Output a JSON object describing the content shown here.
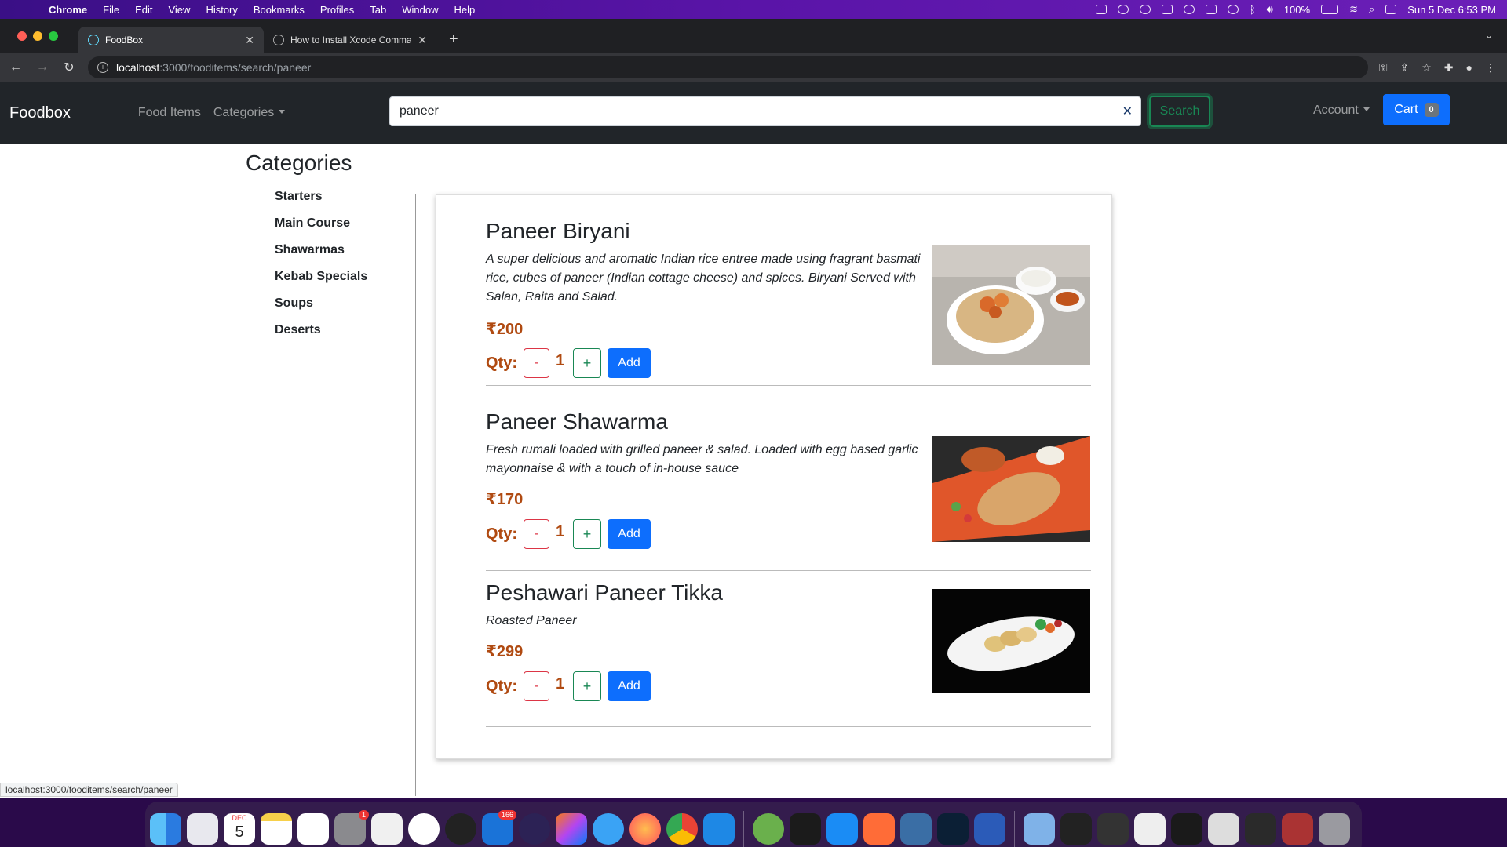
{
  "menubar": {
    "app": "Chrome",
    "items": [
      "File",
      "Edit",
      "View",
      "History",
      "Bookmarks",
      "Profiles",
      "Tab",
      "Window",
      "Help"
    ],
    "battery": "100%",
    "datetime": "Sun 5 Dec  6:53 PM"
  },
  "browser": {
    "tabs": [
      {
        "title": "FoodBox",
        "active": true
      },
      {
        "title": "How to Install Xcode Command",
        "active": false
      }
    ],
    "url_host": "localhost",
    "url_path": ":3000/fooditems/search/paneer",
    "status_url": "localhost:3000/fooditems/search/paneer"
  },
  "navbar": {
    "brand": "Foodbox",
    "food_items": "Food Items",
    "categories": "Categories",
    "search_value": "paneer",
    "search_clear": "✕",
    "search_button": "Search",
    "account": "Account",
    "cart_label": "Cart",
    "cart_count": "0"
  },
  "sidebar": {
    "title": "Categories",
    "items": [
      "Starters",
      "Main Course",
      "Shawarmas",
      "Kebab Specials",
      "Soups",
      "Deserts"
    ]
  },
  "results": [
    {
      "name": "Paneer Biryani",
      "description": "A super delicious and aromatic Indian rice entree made using fragrant basmati rice, cubes of paneer (Indian cottage cheese) and spices. Biryani Served with Salan, Raita and Salad.",
      "price": "₹200",
      "qty_label": "Qty:",
      "qty": "1",
      "minus": "-",
      "plus": "+",
      "add": "Add"
    },
    {
      "name": "Paneer Shawarma",
      "description": "Fresh rumali loaded with grilled paneer & salad. Loaded with egg based garlic mayonnaise & with a touch of in-house sauce",
      "price": "₹170",
      "qty_label": "Qty:",
      "qty": "1",
      "minus": "-",
      "plus": "+",
      "add": "Add"
    },
    {
      "name": "Peshawari Paneer Tikka",
      "description": "Roasted Paneer",
      "price": "₹299",
      "qty_label": "Qty:",
      "qty": "1",
      "minus": "-",
      "plus": "+",
      "add": "Add"
    }
  ],
  "dock": {
    "calendar_month": "DEC",
    "calendar_day": "5",
    "settings_badge": "1",
    "outlook_badge": "166"
  },
  "colors": {
    "accent": "#0d6efd",
    "price": "#b04a11",
    "navbar_bg": "#212529",
    "search_green": "#198754",
    "minus_red": "#dc3545"
  }
}
